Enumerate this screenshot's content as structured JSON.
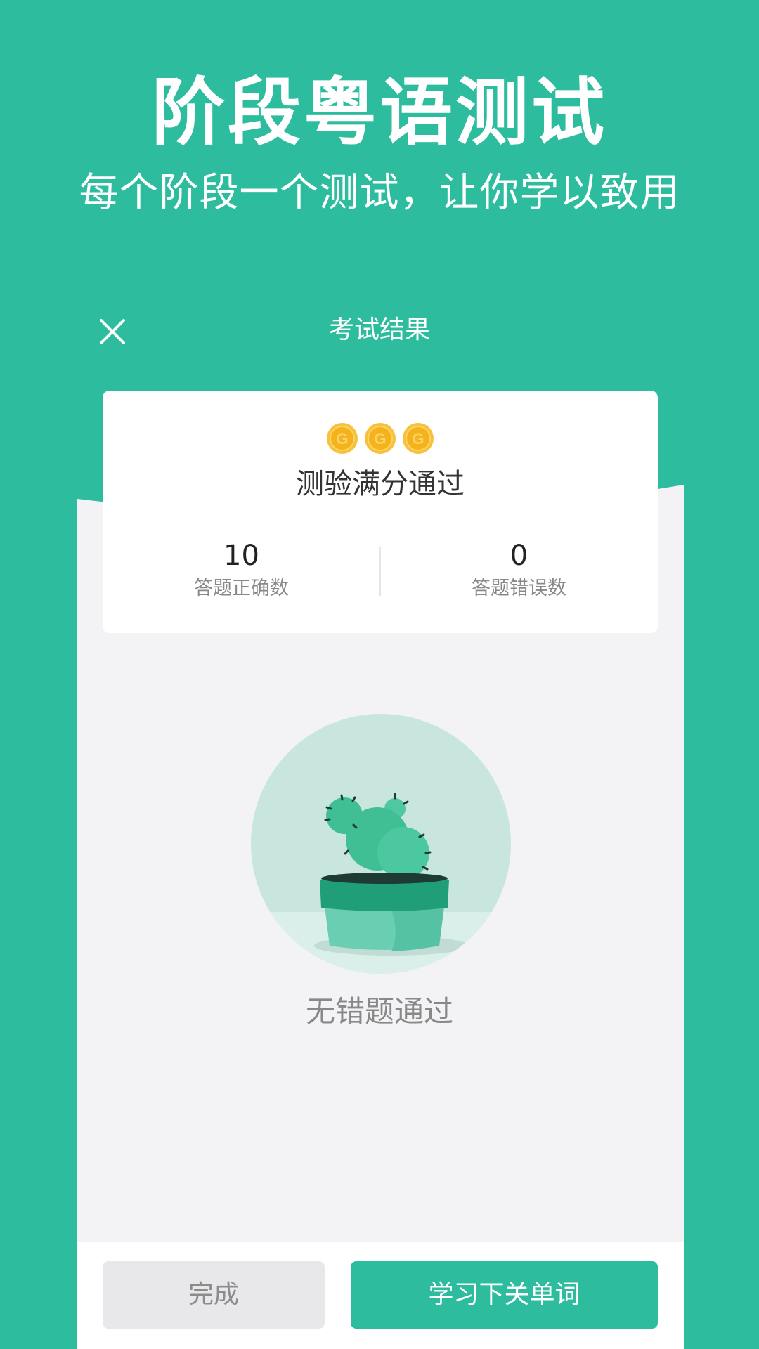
{
  "promo": {
    "title": "阶段粤语测试",
    "subtitle": "每个阶段一个测试，让你学以致用"
  },
  "header": {
    "title": "考试结果",
    "close_icon": "close-icon"
  },
  "result": {
    "coins": [
      "G",
      "G",
      "G"
    ],
    "message": "测验满分通过",
    "correct": {
      "value": "10",
      "label": "答题正确数"
    },
    "wrong": {
      "value": "0",
      "label": "答题错误数"
    }
  },
  "illustration": {
    "icon": "cactus-pot-icon",
    "caption": "无错题通过"
  },
  "actions": {
    "done_label": "完成",
    "next_label": "学习下关单词"
  },
  "colors": {
    "brand": "#2dbd9e",
    "panel": "#f3f3f5",
    "coin": "#f5b21b"
  }
}
